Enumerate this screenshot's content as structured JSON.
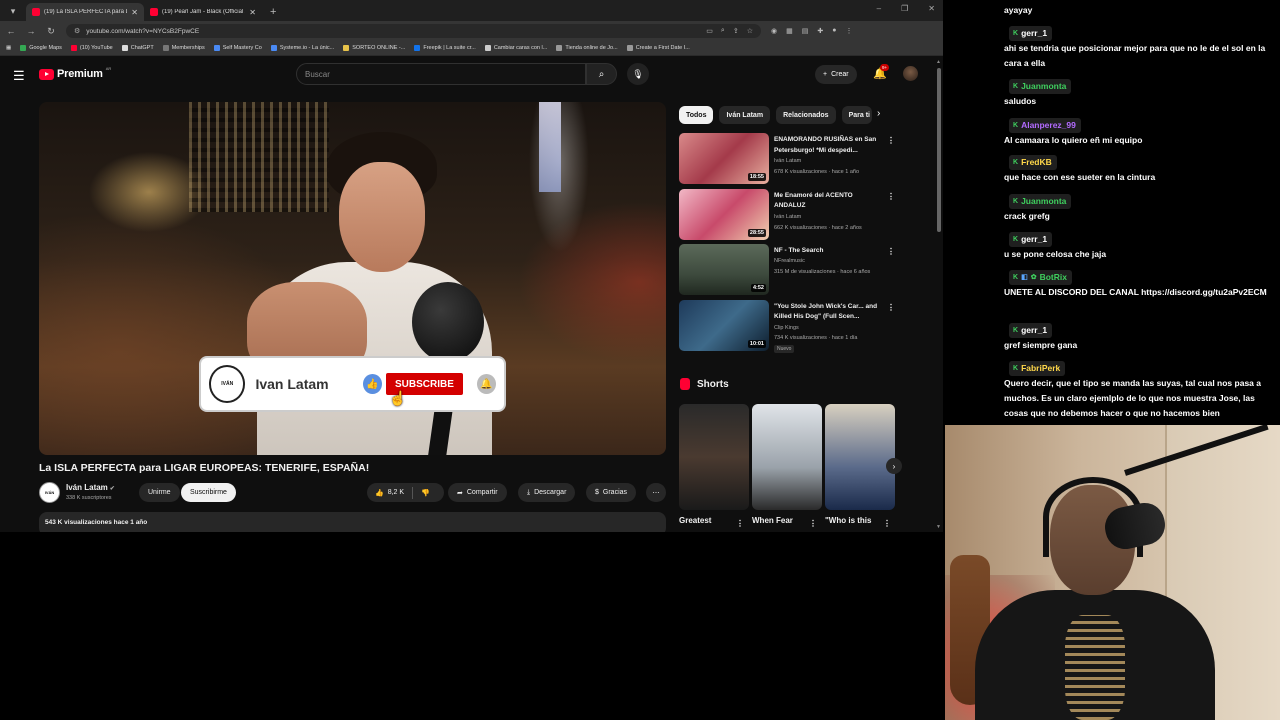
{
  "browser": {
    "tabs": [
      {
        "title": "(19) La ISLA PERFECTA para LIG",
        "active": true
      },
      {
        "title": "(19) Pearl Jam - Black (Official /",
        "active": false
      }
    ],
    "url": "youtube.com/watch?v=NYCsB2FpwCE",
    "bookmarks": [
      "Google Maps",
      "(10) YouTube",
      "ChatGPT",
      "Memberships",
      "Self Mastery Co",
      "Systeme.io - La únic...",
      "SORTEO ONLINE -...",
      "Freepik | La suite cr...",
      "Cambiar caras con l...",
      "Tienda online de Jo...",
      "Create a First Date I..."
    ]
  },
  "header": {
    "logo_text": "Premium",
    "country": "AR",
    "search_placeholder": "Buscar",
    "create_label": "Crear",
    "notif_badge": "9+"
  },
  "player": {
    "card_name": "Ivan Latam",
    "card_logo": "IVÁN",
    "card_subscribe": "SUBSCRIBE"
  },
  "video": {
    "title": "La ISLA PERFECTA para LIGAR EUROPEAS: TENERIFE, ESPAÑA!",
    "channel": "Iván Latam",
    "subscribers": "338 K suscriptores",
    "join": "Unirme",
    "subscribe": "Suscribirme",
    "likes": "8,2 K",
    "share": "Compartir",
    "download": "Descargar",
    "thanks": "Gracias",
    "views_date": "543 K visualizaciones  hace 1 año"
  },
  "sidebar": {
    "chips": [
      "Todos",
      "Iván Latam",
      "Relacionados",
      "Para ti"
    ],
    "recommended": [
      {
        "title": "ENAMORANDO RUSIÑAS en San Petersburgo! *Mi despedi...",
        "channel": "Iván Latam",
        "meta": "678 K visualizaciones · hace 1 año",
        "duration": "18:55",
        "badge": ""
      },
      {
        "title": "Me Enamoré del ACENTO ANDALUZ",
        "channel": "Iván Latam",
        "meta": "662 K visualizaciones · hace 2 años",
        "duration": "28:55",
        "badge": ""
      },
      {
        "title": "NF - The Search",
        "channel": "NFrealmusic",
        "meta": "315 M de visualizaciones · hace 6 años",
        "duration": "4:52",
        "badge": ""
      },
      {
        "title": "\"You Stole John Wick's Car... and Killed His Dog\" (Full Scen...",
        "channel": "Clip Kings",
        "meta": "734 K visualizaciones · hace 1 día",
        "duration": "10:01",
        "badge": "Nuevo"
      }
    ],
    "shorts_title": "Shorts",
    "shorts": [
      {
        "label": "Greatest"
      },
      {
        "label": "When Fear"
      },
      {
        "label": "\"Who is this"
      }
    ]
  },
  "chat": {
    "messages": [
      {
        "user": "",
        "badge": "",
        "color": "#ffffff",
        "text": "ayayay"
      },
      {
        "user": "gerr_1",
        "badge": "K",
        "color": "#ffffff",
        "text": "ahi se tendria que posicionar mejor para que no le de el sol en la cara a ella"
      },
      {
        "user": "Juanmonta",
        "badge": "K",
        "color": "#3fcf5e",
        "text": "saludos"
      },
      {
        "user": "Alanperez_99",
        "badge": "K",
        "color": "#b36bff",
        "text": "Al camaara lo quiero eñ mi equipo"
      },
      {
        "user": "FredKB",
        "badge": "K",
        "color": "#ffd84a",
        "text": "que hace con ese sueter en la cintura"
      },
      {
        "user": "Juanmonta",
        "badge": "K",
        "color": "#3fcf5e",
        "text": "crack grefg"
      },
      {
        "user": "gerr_1",
        "badge": "K",
        "color": "#ffffff",
        "text": "u se pone celosa che jaja"
      },
      {
        "user": "BotRix",
        "badge": "K",
        "color": "#3fcf5e",
        "text": "UNETE AL DISCORD DEL CANAL https://discord.gg/tu2aPv2ECM"
      },
      {
        "user": "gerr_1",
        "badge": "K",
        "color": "#ffffff",
        "text": "gref siempre gana"
      },
      {
        "user": "FabriPerk",
        "badge": "K",
        "color": "#ffd84a",
        "text": "Quero decir, que el tipo se manda las suyas, tal cual nos pasa a muchos. Es un claro ejemlplo de lo que nos muestra Jose, las cosas que no debemos hacer o que no hacemos bien"
      }
    ]
  },
  "colors": {
    "yt_red": "#ff0033",
    "subscribe_red": "#d40000",
    "bg_dark": "#0f0f0f",
    "chip_bg": "#272727"
  }
}
